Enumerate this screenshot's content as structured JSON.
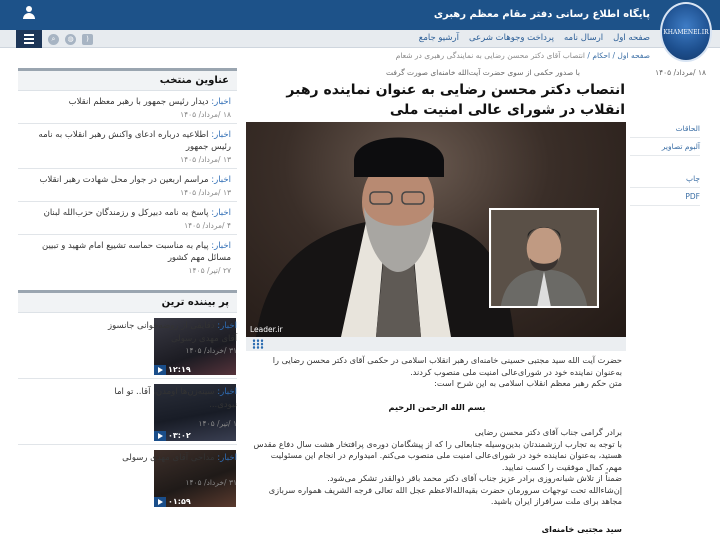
{
  "header": {
    "site_title": "پایگاه اطلاع رسانی دفتر مقام معظم رهبری",
    "logo_text": "KHAMENEI.IR"
  },
  "nav": {
    "links": [
      "صفحه اول",
      "ارسال نامه",
      "پرداخت وجوهات شرعی",
      "آرشیو جامع"
    ]
  },
  "breadcrumb": {
    "home": "صفحه اول",
    "section": "احکام",
    "current": "انتصاب آقای دکتر محسن رضایی به نمایندگی رهبری در شعام"
  },
  "article": {
    "kicker": "با صدور حکمی از سوی حضرت آیت‌الله خامنه‌ای صورت گرفت",
    "date": "۱۸ /مرداد/ ۱۴۰۵",
    "headline": "انتصاب دکتر محسن رضایی به عنوان نماینده رهبر انقلاب در شورای عالی امنیت ملی",
    "image_watermark": "Leader.ir",
    "intro1": "حضرت آیت الله سید مجتبی حسینی خامنه‌ای رهبر انقلاب اسلامی در حکمی آقای دکتر محسن رضایی را به‌عنوان نماینده خود در شورای‌عالی امنیت ملی منصوب کردند.",
    "intro2": "متن حکم رهبر معظم انقلاب اسلامی به این شرح است:",
    "bismillah": "بسم الله الرحمن الرحیم",
    "p1": "برادر گرامی جناب آقای دکتر محسن رضایی",
    "p2": "با توجه به تجارب ارزشمندتان بدین‌وسیله جنابعالی را که از پیشگامان دوره‌ی پرافتخار هشت سال دفاع مقدس هستید، به‌عنوان نماینده خود در شورای‌عالی امنیت ملی منصوب می‌کنم. امیدوارم در انجام این مسئولیت مهم، کمال موفقیت را کسب نمایید.",
    "p3": "ضمناً از تلاش شبانه‌روزی برادر عزیز جناب آقای دکتر محمد باقر ذوالقدر تشکر می‌شود.",
    "p4": "إن‌شاءالله تحت توجهات سرورمان حضرت بقیه‌الله‌الاعظم عجل الله تعالی فرجه الشریف همواره سربازی مجاهد برای ملت سرافراز ایران باشید.",
    "signature": "سید مجتبی خامنه‌ای"
  },
  "sidetools": {
    "items": [
      "الحاقات",
      "آلبوم تصاویر",
      "چاپ",
      "PDF"
    ]
  },
  "selected": {
    "title": "عناوین منتخب",
    "tag": "اخبار:",
    "items": [
      {
        "title": "دیدار رئیس جمهور با رهبر معظم انقلاب",
        "date": "۱۸ /مرداد/ ۱۴۰۵"
      },
      {
        "title": "اطلاعیه درباره ادعای واکنش رهبر انقلاب به نامه رئیس جمهور",
        "date": "۱۳ /مرداد/ ۱۴۰۵"
      },
      {
        "title": "مراسم اربعین در جوار محل شهادت رهبر انقلاب",
        "date": "۱۳ /مرداد/ ۱۴۰۵"
      },
      {
        "title": "پاسخ به نامه دبیرکل و رزمندگان حزب‌الله لبنان",
        "date": "۴ /مرداد/ ۱۴۰۵"
      },
      {
        "title": "پیام به مناسبت حماسه تشییع امام شهید و تبیین مسائل مهم کشور",
        "date": "۲۷ /تیر/ ۱۴۰۵"
      }
    ]
  },
  "most_viewed": {
    "title": "پر بیننده ترین",
    "tag": "اخبار:",
    "items": [
      {
        "title": "دقایقی از روضه‌خوانی جانسوز آقای مهدی رسولی",
        "date": "۳۱ /خرداد/ ۱۴۰۵",
        "duration": "۱۲:۱۹"
      },
      {
        "title": "سینه‌زن‌ها اومدن، آقا.. تو اما نبودی...",
        "date": "۱ /تیر/ ۱۴۰۵",
        "duration": "۰۳:۰۲"
      },
      {
        "title": "مداحی آقای مهدی رسولی",
        "date": "۳۱ /خرداد/ ۱۴۰۵",
        "duration": "۰۱:۵۹"
      }
    ]
  }
}
